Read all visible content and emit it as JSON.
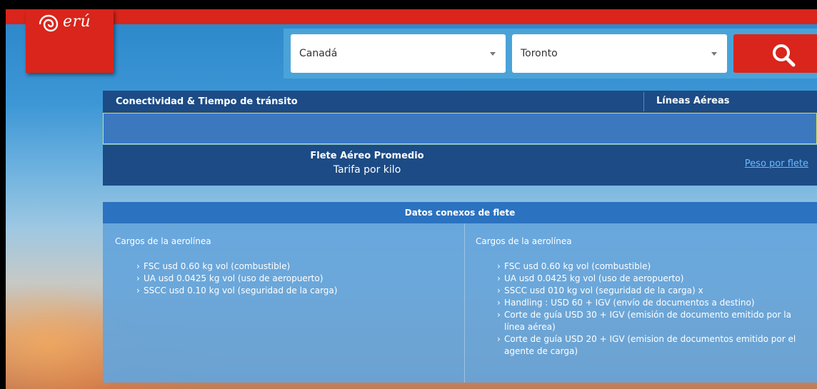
{
  "logo": {
    "text": "erú"
  },
  "search": {
    "country": "Canadá",
    "city": "Toronto"
  },
  "header": {
    "connectivity": "Conectividad & Tiempo de tránsito",
    "airlines": "Líneas Aéreas"
  },
  "freight": {
    "title": "Flete Aéreo Promedio",
    "subtitle": "Tarifa por kilo",
    "link": "Peso por flete"
  },
  "datos": {
    "title": "Datos conexos de flete",
    "left": {
      "title": "Cargos de la aerolínea",
      "items": [
        "FSC usd 0.60 kg vol (combustible)",
        "UA usd 0.0425 kg vol (uso de aeropuerto)",
        "SSCC usd 0.10 kg vol (seguridad de la carga)"
      ]
    },
    "right": {
      "title": "Cargos de la aerolínea",
      "items": [
        "FSC usd 0.60 kg vol (combustible)",
        "UA usd 0.0425 kg vol (uso de aeropuerto)",
        "SSCC usd 010 kg vol (seguridad de la carga) x",
        "Handling : USD 60 + IGV (envío de documentos a destino)",
        "Corte de guía USD 30 + IGV (emisión de documento emitido por la línea aérea)",
        "Corte de guía USD 20 + IGV (emision de documentos emitido por el agente de carga)"
      ]
    }
  },
  "colors": {
    "brand_red": "#d9251c",
    "navy": "#1c4b85",
    "link": "#6cb9ff"
  },
  "icons": {
    "search": "magnifier-icon",
    "caret": "caret-down-icon",
    "logo": "peru-spiral-logo"
  }
}
